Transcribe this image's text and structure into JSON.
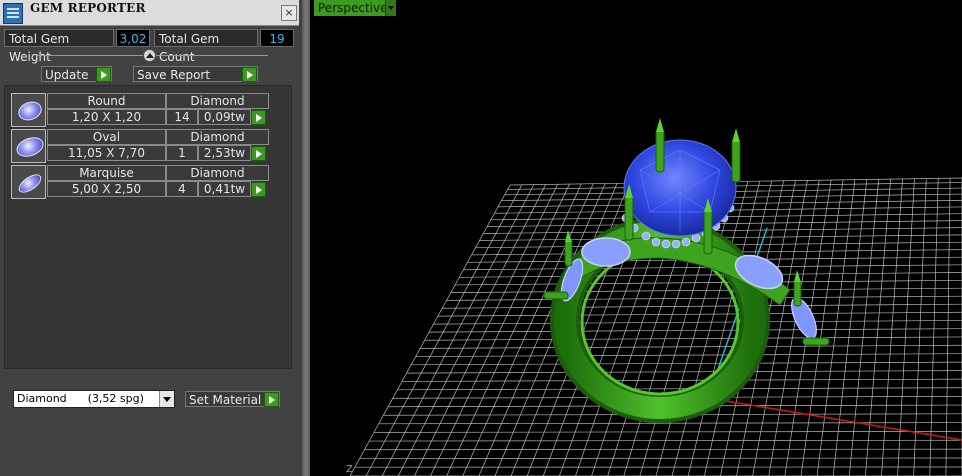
{
  "panel": {
    "title": "GEM REPORTER",
    "close_symbol": "×",
    "total_weight_label": "Total Gem Weight",
    "total_weight_value": "3,02",
    "total_count_label": "Total Gem Count",
    "total_count_value": "19",
    "update_label": "Update",
    "save_report_label": "Save Report",
    "gems": [
      {
        "shape": "Round",
        "size": "1,20 X 1,20",
        "material": "Diamond",
        "count": "14",
        "weight": "0,09tw"
      },
      {
        "shape": "Oval",
        "size": "11,05 X 7,70",
        "material": "Diamond",
        "count": "1",
        "weight": "2,53tw"
      },
      {
        "shape": "Marquise",
        "size": "5,00 X 2,50",
        "material": "Diamond",
        "count": "4",
        "weight": "0,41tw"
      }
    ],
    "material_select": "Diamond      (3,52 spg)",
    "set_material_label": "Set Material"
  },
  "viewport": {
    "view_name": "Perspective",
    "axis_label": "Z"
  },
  "colors": {
    "accent_green": "#3d9a1f",
    "value_blue": "#3fb6e8",
    "ring_metal": "#3fa81f",
    "gem_blue": "#3b50e8"
  }
}
